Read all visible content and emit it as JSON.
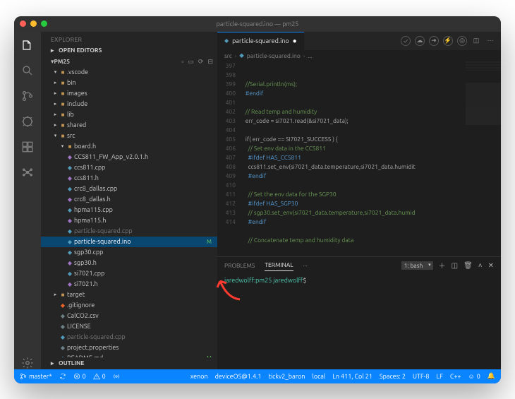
{
  "titlebar": {
    "title": "particle-squared.ino — pm25"
  },
  "activity": {
    "items": [
      "files-icon",
      "search-icon",
      "source-control-icon",
      "debug-icon",
      "extensions-icon",
      "test-icon"
    ],
    "bottom": [
      "settings-icon"
    ]
  },
  "sidebar": {
    "title": "EXPLORER",
    "open_editors_label": "OPEN EDITORS",
    "workspace": "PM25",
    "header_icons": [
      "new-file",
      "new-folder",
      "refresh",
      "collapse"
    ],
    "outline_label": "OUTLINE",
    "tree": [
      {
        "d": 1,
        "t": "folder",
        "open": true,
        "n": ".vscode"
      },
      {
        "d": 1,
        "t": "folder",
        "open": false,
        "n": "bin"
      },
      {
        "d": 1,
        "t": "folder",
        "open": false,
        "n": "images"
      },
      {
        "d": 1,
        "t": "folder",
        "open": false,
        "n": "include"
      },
      {
        "d": 1,
        "t": "folder",
        "open": false,
        "n": "lib"
      },
      {
        "d": 1,
        "t": "folder",
        "open": false,
        "n": "shared"
      },
      {
        "d": 1,
        "t": "folder",
        "open": true,
        "n": "src"
      },
      {
        "d": 2,
        "t": "folder",
        "open": true,
        "n": "board.h",
        "fic": "file-h"
      },
      {
        "d": 2,
        "t": "file",
        "fic": "file-h",
        "n": "CCS811_FW_App_v2.0.1.h"
      },
      {
        "d": 2,
        "t": "file",
        "fic": "file-c",
        "n": "ccs811.cpp"
      },
      {
        "d": 2,
        "t": "file",
        "fic": "file-h",
        "n": "ccs811.h"
      },
      {
        "d": 2,
        "t": "file",
        "fic": "file-c",
        "n": "crc8_dallas.cpp"
      },
      {
        "d": 2,
        "t": "file",
        "fic": "file-h",
        "n": "crc8_dallas.h"
      },
      {
        "d": 2,
        "t": "file",
        "fic": "file-c",
        "n": "hpma115.cpp"
      },
      {
        "d": 2,
        "t": "file",
        "fic": "file-h",
        "n": "hpma115.h"
      },
      {
        "d": 2,
        "t": "file",
        "fic": "file-c",
        "n": "particle-squared.cpp",
        "dim": true
      },
      {
        "d": 2,
        "t": "file",
        "fic": "file-c",
        "n": "particle-squared.ino",
        "sel": true,
        "badge": "M"
      },
      {
        "d": 2,
        "t": "file",
        "fic": "file-c",
        "n": "sgp30.cpp"
      },
      {
        "d": 2,
        "t": "file",
        "fic": "file-h",
        "n": "sgp30.h"
      },
      {
        "d": 2,
        "t": "file",
        "fic": "file-c",
        "n": "si7021.cpp"
      },
      {
        "d": 2,
        "t": "file",
        "fic": "file-h",
        "n": "si7021.h"
      },
      {
        "d": 1,
        "t": "folder",
        "open": false,
        "n": "target"
      },
      {
        "d": 1,
        "t": "file",
        "fic": "file-git",
        "n": ".gitignore"
      },
      {
        "d": 1,
        "t": "file",
        "fic": "file-txt",
        "n": "CalCO2.csv"
      },
      {
        "d": 1,
        "t": "file",
        "fic": "file-txt",
        "n": "LICENSE"
      },
      {
        "d": 1,
        "t": "file",
        "fic": "file-c",
        "n": "particle-squared.cpp",
        "dim": true
      },
      {
        "d": 1,
        "t": "file",
        "fic": "file-txt",
        "n": "project.properties"
      },
      {
        "d": 1,
        "t": "file",
        "fic": "file-md",
        "n": "README.md",
        "badge": "M"
      }
    ]
  },
  "editor": {
    "tab_label": "particle-squared.ino",
    "tab_dirty": true,
    "breadcrumb": [
      "src",
      "particle-squared.ino",
      "..."
    ],
    "actions": [
      "check",
      "cloud",
      "arrow-right",
      "zap",
      "eye",
      "split",
      "more"
    ],
    "first_line": 397,
    "lines": [
      {
        "cls": "c-cm",
        "t": "    //Serial.println(ms);"
      },
      {
        "cls": "c-mc",
        "t": "    #endif"
      },
      {
        "cls": "",
        "t": ""
      },
      {
        "cls": "c-cm",
        "t": "    // Read temp and humidity"
      },
      {
        "cls": "",
        "t": "    err_code = si7021.read(&si7021_data);"
      },
      {
        "cls": "",
        "t": ""
      },
      {
        "cls": "",
        "t": "    if( err_code == SI7021_SUCCESS ) {"
      },
      {
        "cls": "c-cm",
        "t": "      // Set env data in the CCS811"
      },
      {
        "cls": "c-mc",
        "t": "      #ifdef HAS_CCS811"
      },
      {
        "cls": "",
        "t": "      ccs811.set_env(si7021_data.temperature,si7021_data.humidit"
      },
      {
        "cls": "c-mc",
        "t": "      #endif"
      },
      {
        "cls": "",
        "t": ""
      },
      {
        "cls": "c-cm",
        "t": "      // Set the env data for the SGP30"
      },
      {
        "cls": "c-mc",
        "t": "      #ifdef HAS_SGP30"
      },
      {
        "cls": "c-cm",
        "t": "      // sgp30.set_env(si7021_data.temperature,si7021_data.humid"
      },
      {
        "cls": "c-mc",
        "t": "      #endif"
      },
      {
        "cls": "",
        "t": ""
      },
      {
        "cls": "c-cm",
        "t": "      // Concatenate temp and humidity data"
      }
    ]
  },
  "panel": {
    "tabs": [
      "PROBLEMS",
      "TERMINAL",
      "···"
    ],
    "active": 1,
    "shell_label": "1: bash",
    "icons": [
      "plus",
      "split",
      "trash",
      "chev-up",
      "close"
    ],
    "term_line": {
      "host": "jaredwolff",
      "sep": ":",
      "path": "pm25",
      "user": " jaredwolff",
      "prompt": "$"
    }
  },
  "status": {
    "left": [
      {
        "icon": "branch",
        "t": "master*"
      },
      {
        "icon": "sync",
        "t": ""
      },
      {
        "icon": "error",
        "t": "0"
      },
      {
        "icon": "warn",
        "t": "0"
      },
      {
        "icon": "broadcast",
        "t": ""
      }
    ],
    "right": [
      {
        "t": "xenon"
      },
      {
        "t": "deviceOS@1.4.1"
      },
      {
        "t": "tickv2_baron"
      },
      {
        "t": "local"
      },
      {
        "t": "Ln 411, Col 21"
      },
      {
        "t": "Spaces: 2"
      },
      {
        "t": "UTF-8"
      },
      {
        "t": "LF"
      },
      {
        "t": "C++"
      },
      {
        "icon": "smile",
        "t": "0"
      },
      {
        "icon": "bell",
        "t": ""
      }
    ]
  }
}
